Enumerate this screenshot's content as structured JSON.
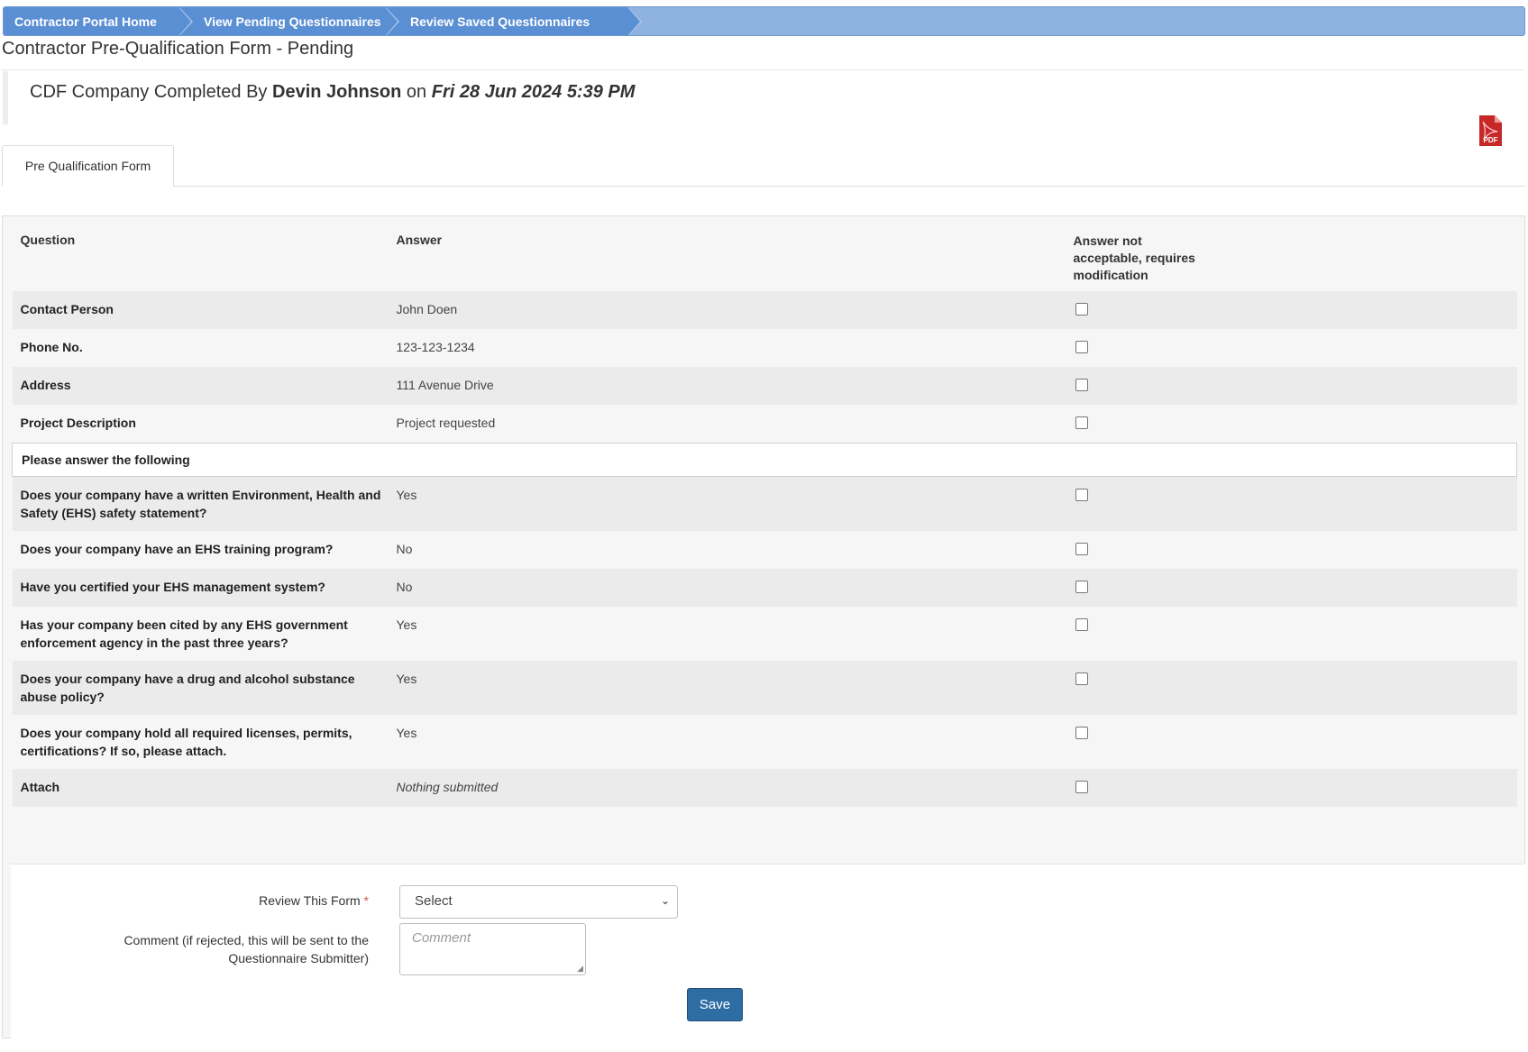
{
  "breadcrumb": {
    "items": [
      {
        "label": "Contractor Portal Home"
      },
      {
        "label": "View Pending Questionnaires"
      },
      {
        "label": "Review Saved Questionnaires"
      }
    ]
  },
  "page": {
    "title": "Contractor Pre-Qualification Form - Pending"
  },
  "completion": {
    "company_text": "CDF Company Completed By",
    "completed_by": "Devin Johnson",
    "on_text": "on",
    "date": "Fri 28 Jun 2024 5:39 PM"
  },
  "pdf_icon": {
    "name": "pdf-icon",
    "label": "PDF"
  },
  "tabs": [
    {
      "label": "Pre Qualification Form"
    }
  ],
  "table": {
    "headers": {
      "question": "Question",
      "answer": "Answer",
      "not_acceptable": "Answer not acceptable, requires modification"
    },
    "basic_rows": [
      {
        "question": "Contact Person",
        "answer": "John Doen"
      },
      {
        "question": "Phone No.",
        "answer": "123-123-1234"
      },
      {
        "question": "Address",
        "answer": "111 Avenue Drive"
      },
      {
        "question": "Project Description",
        "answer": "Project requested"
      }
    ],
    "section_title": "Please answer the following",
    "section_rows": [
      {
        "question": "Does your company have a written Environment, Health and Safety (EHS) safety statement?",
        "answer": "Yes"
      },
      {
        "question": "Does your company have an EHS training program?",
        "answer": "No"
      },
      {
        "question": "Have you certified your EHS management system?",
        "answer": "No"
      },
      {
        "question": "Has your company been cited by any EHS government enforcement agency in the past three years?",
        "answer": "Yes"
      },
      {
        "question": "Does your company have a drug and alcohol substance abuse policy?",
        "answer": "Yes"
      },
      {
        "question": "Does your company hold all required licenses, permits, certifications? If so, please attach.",
        "answer": "Yes"
      },
      {
        "question": "Attach",
        "answer": "Nothing submitted"
      }
    ]
  },
  "review_form": {
    "review_label": "Review This Form",
    "required_mark": "*",
    "select_value": "Select",
    "comment_label": "Comment (if rejected, this will be sent to the Questionnaire Submitter)",
    "comment_placeholder": "Comment",
    "save_label": "Save"
  },
  "colors": {
    "breadcrumb_bg": "#8fb3e0",
    "crumb_bg": "#5b8fd4",
    "save_button": "#2e6da4",
    "required": "#d9534f",
    "pdf_red": "#c62828"
  }
}
